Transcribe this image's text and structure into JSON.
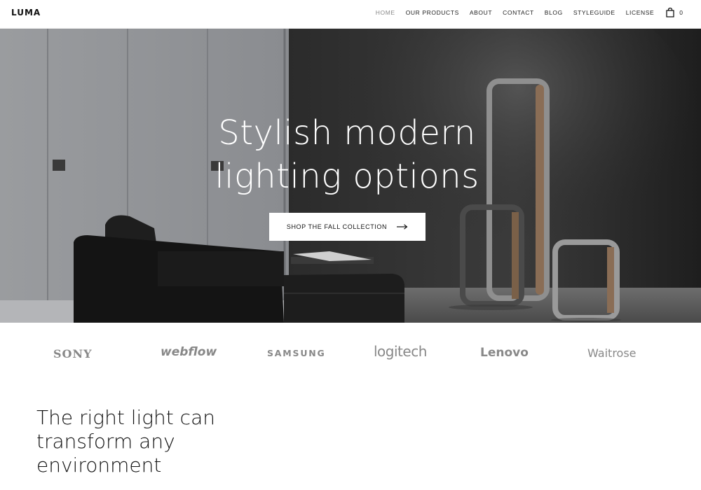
{
  "brand": {
    "logo_text": "LUMA"
  },
  "nav": {
    "items": [
      {
        "label": "HOME",
        "active": true
      },
      {
        "label": "OUR PRODUCTS",
        "active": false
      },
      {
        "label": "ABOUT",
        "active": false
      },
      {
        "label": "CONTACT",
        "active": false
      },
      {
        "label": "BLOG",
        "active": false
      },
      {
        "label": "STYLEGUIDE",
        "active": false
      },
      {
        "label": "LICENSE",
        "active": false
      }
    ],
    "cart": {
      "icon": "shopping-bag-icon",
      "count": "0"
    }
  },
  "hero": {
    "title_line1": "Stylish modern",
    "title_line2": "lighting options",
    "cta_label": "SHOP THE FALL COLLECTION",
    "cta_icon": "arrow-right-icon"
  },
  "logos": {
    "sony": "SONY",
    "webflow": "webflow",
    "samsung": "SAMSUNG",
    "logitech": "logitech",
    "lenovo": "Lenovo",
    "waitrose": "Waitrose"
  },
  "intro": {
    "line1": "The right light can",
    "line2": "transform any",
    "line3": "environment"
  },
  "colors": {
    "nav_bg": "#ffffff",
    "hero_dark": "#262626",
    "logo_gray": "#888888",
    "lamp_wood": "#8a6d55"
  }
}
